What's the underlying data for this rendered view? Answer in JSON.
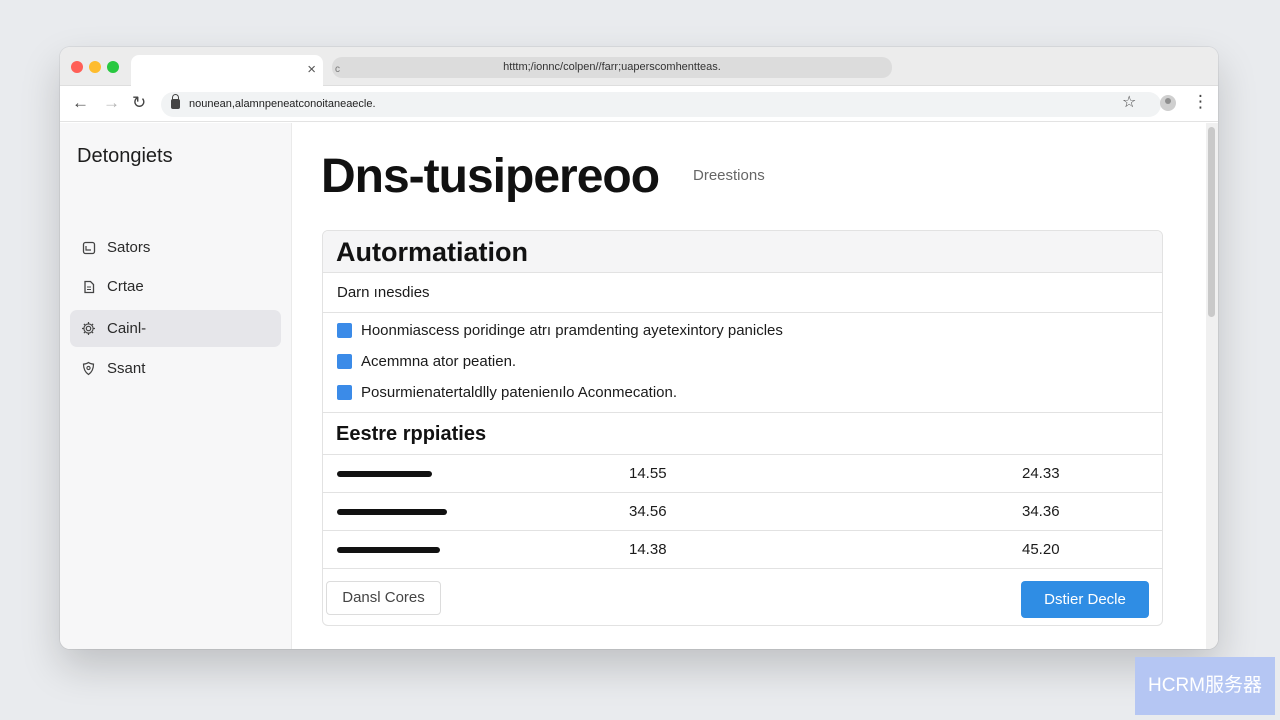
{
  "browser": {
    "tab_close": "×",
    "tab_url": "htttm;/ionnc/colpen//farr;uaperscomhentteas.",
    "tab_url_dot": "c",
    "address": "nounean,alamnpeneatconoitaneaecle.",
    "icons": {
      "back": "arrow-left-icon",
      "forward": "arrow-right-icon",
      "reload": "reload-icon",
      "star": "star-icon",
      "menu": "more-vertical-icon"
    }
  },
  "sidebar": {
    "title": "Detongiets",
    "items": [
      {
        "label": "Sators",
        "icon": "box-icon",
        "active": false
      },
      {
        "label": "Crtae",
        "icon": "document-icon",
        "active": false
      },
      {
        "label": "Cainl-",
        "icon": "gear-icon",
        "active": true
      },
      {
        "label": "Ssant",
        "icon": "shield-icon",
        "active": false
      }
    ]
  },
  "main": {
    "title": "Dns-tusipereoo",
    "subtitle": "Dreestions",
    "card": {
      "title": "Autormatiation",
      "subtitle": "Darn ınesdies",
      "bullets": [
        "Hoonmiascess poridinge atrı pramdenting ayetexintory panicles",
        "Acemmna ator peatien.",
        "Posurmienatertaldlly patenienılo Aconmecation."
      ],
      "section_title": "Eestre rppiaties",
      "rows": [
        {
          "bar": 0.63,
          "c2": "14.55",
          "c3": "24.33"
        },
        {
          "bar": 0.73,
          "c2": "34.56",
          "c3": "34.36"
        },
        {
          "bar": 0.69,
          "c2": "14.38",
          "c3": "45.20"
        }
      ],
      "secondary_button": "Dansl Cores",
      "primary_button": "Dstier Decle"
    }
  },
  "colors": {
    "accent": "#2f8de4",
    "bullet": "#3b8be8"
  },
  "watermark": "HCRM服务器"
}
